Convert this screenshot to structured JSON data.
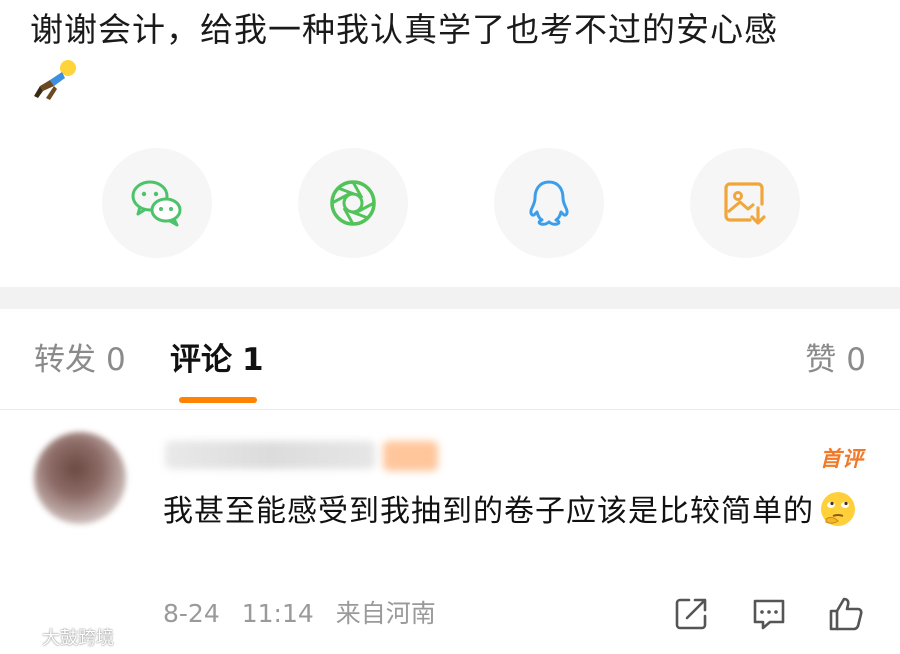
{
  "post": {
    "text": "谢谢会计，给我一种我认真学了也考不过的安心感",
    "emoji": "sleeping-person-emoji"
  },
  "share_bar": {
    "items": [
      {
        "name": "wechat",
        "icon": "wechat-icon",
        "color": "#4cc26b"
      },
      {
        "name": "moments",
        "icon": "moments-icon",
        "color": "#52c35a"
      },
      {
        "name": "qq",
        "icon": "qq-icon",
        "color": "#3c9eea"
      },
      {
        "name": "save-image",
        "icon": "save-image-icon",
        "color": "#f0a63a"
      }
    ]
  },
  "tabs": {
    "repost": {
      "label": "转发",
      "count": "0"
    },
    "comment": {
      "label": "评论",
      "count": "1"
    },
    "like": {
      "label": "赞",
      "count": "0"
    },
    "active": "comment",
    "accent": "#ff8200"
  },
  "comment": {
    "first_badge": "首评",
    "text": "我甚至能感受到我抽到的卷子应该是比较简单的",
    "emoji": "thinking-eyeroll-emoji",
    "date": "8-24",
    "time": "11:14",
    "location": "来自河南"
  },
  "watermark": {
    "text": "大鼓跨境"
  }
}
